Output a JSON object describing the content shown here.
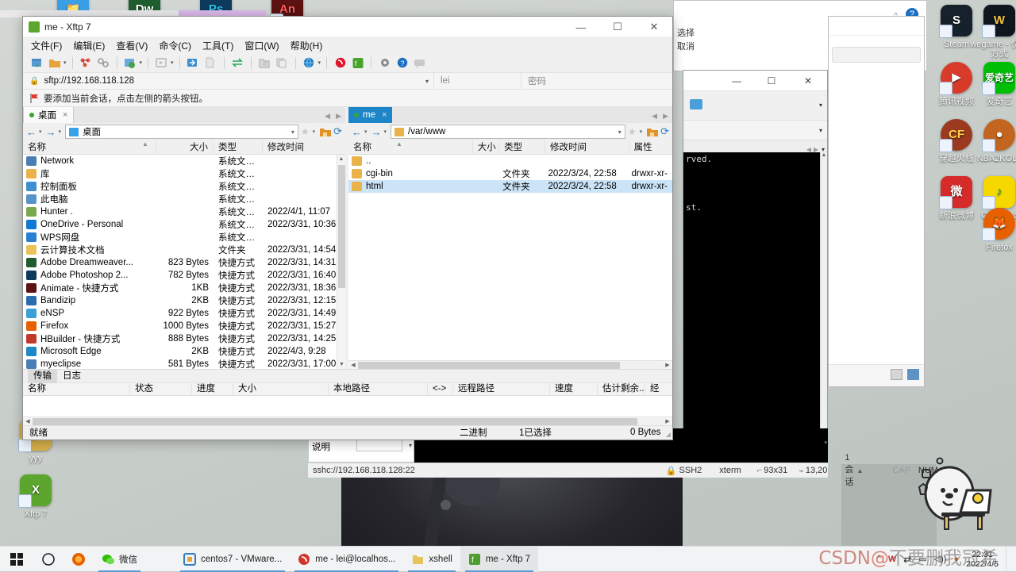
{
  "desktop": {
    "icons_right": [
      {
        "label": "Steam",
        "color": "#1b2838",
        "glyph": "S"
      },
      {
        "label": "wegame - 快捷方式",
        "color": "#101820",
        "glyph": "W"
      },
      {
        "label": "腾讯视频",
        "color": "#d93b2b",
        "glyph": "▶"
      },
      {
        "label": "爱奇艺",
        "color": "#00be06",
        "glyph": "奇"
      },
      {
        "label": "穿越火线",
        "color": "#8c2b1e",
        "glyph": "CF"
      },
      {
        "label": "NBA2KOL2",
        "color": "#c1651f",
        "glyph": "●"
      },
      {
        "label": "新浪微博",
        "color": "#d62b2b",
        "glyph": "微"
      },
      {
        "label": "QQMusic",
        "color": "#f5d800",
        "glyph": "♪"
      },
      {
        "label": "Firefox",
        "color": "#e66000",
        "glyph": "🦊"
      }
    ],
    "icons_left": [
      {
        "label": "yyy",
        "color": "#c9a227",
        "glyph": "📁"
      },
      {
        "label": "Xftp 7",
        "color": "#4f9d2e",
        "glyph": "X"
      }
    ],
    "icons_top": [
      {
        "label": "",
        "color": "#39a0e8",
        "glyph": "📁"
      },
      {
        "label": "Dw",
        "color": "#1f5c2e",
        "glyph": "Dw"
      },
      {
        "label": "Ps",
        "color": "#0b3a5d",
        "glyph": "Ps"
      },
      {
        "label": "An",
        "color": "#5c1212",
        "glyph": "An"
      }
    ]
  },
  "xftp": {
    "title": "me - Xftp 7",
    "window_icon": "xftp-app-icon",
    "titlebar_buttons": {
      "minimize": "—",
      "maximize": "☐",
      "close": "✕"
    },
    "menu": [
      "文件(F)",
      "编辑(E)",
      "查看(V)",
      "命令(C)",
      "工具(T)",
      "窗口(W)",
      "帮助(H)"
    ],
    "toolbar_icons": [
      "new-session-icon",
      "open-folder-icon",
      "caret-down-icon",
      "disconnect-icon",
      "link-icon",
      "sync-browse-icon",
      "caret-down-icon",
      "script-run-icon",
      "caret-down-icon",
      "transfer-in-icon",
      "file-icon",
      "transfer-swap-icon",
      "lock-folder-icon",
      "copy-icon",
      "globe-icon",
      "caret-down-icon",
      "xshell-icon",
      "xftp-icon",
      "settings-gear-icon",
      "help-icon",
      "feedback-icon"
    ],
    "address": {
      "lock_icon": "lock-icon",
      "url": "sftp://192.168.118.128",
      "user_placeholder": "lei",
      "password_placeholder": "密码"
    },
    "hint": {
      "icon": "red-flag-icon",
      "text": "要添加当前会话，点击左侧的箭头按钮。"
    },
    "local_pane": {
      "tab": {
        "label": "桌面",
        "close": "×",
        "dot": "session-dot"
      },
      "path": "桌面",
      "nav": {
        "back": "←",
        "forward": "→",
        "star": "★",
        "home": "⌂",
        "refresh": "⟳"
      },
      "columns": [
        "名称",
        "大小",
        "类型",
        "修改时间"
      ],
      "rows": [
        {
          "name": "Network",
          "icon_color": "#4a7fb5",
          "size": "",
          "type": "系统文件夹",
          "modified": ""
        },
        {
          "name": "库",
          "icon_color": "#e9b34a",
          "size": "",
          "type": "系统文件夹",
          "modified": ""
        },
        {
          "name": "控制面板",
          "icon_color": "#3e8fd0",
          "size": "",
          "type": "系统文件夹",
          "modified": ""
        },
        {
          "name": "此电脑",
          "icon_color": "#5a93c8",
          "size": "",
          "type": "系统文件夹",
          "modified": ""
        },
        {
          "name": "Hunter .",
          "icon_color": "#7aa84f",
          "size": "",
          "type": "系统文件夹",
          "modified": "2022/4/1, 11:07"
        },
        {
          "name": "OneDrive - Personal",
          "icon_color": "#0f78d4",
          "size": "",
          "type": "系统文件夹",
          "modified": "2022/3/31, 10:36"
        },
        {
          "name": "WPS网盘",
          "icon_color": "#2a7fd4",
          "size": "",
          "type": "系统文件夹",
          "modified": ""
        },
        {
          "name": "云计算技术文档",
          "icon_color": "#e9c35a",
          "size": "",
          "type": "文件夹",
          "modified": "2022/3/31, 14:54"
        },
        {
          "name": "Adobe Dreamweaver...",
          "icon_color": "#1f5c2e",
          "size": "823 Bytes",
          "type": "快捷方式",
          "modified": "2022/3/31, 14:31"
        },
        {
          "name": "Adobe Photoshop 2...",
          "icon_color": "#0b3a5d",
          "size": "782 Bytes",
          "type": "快捷方式",
          "modified": "2022/3/31, 16:40"
        },
        {
          "name": "Animate - 快捷方式",
          "icon_color": "#5c1212",
          "size": "1KB",
          "type": "快捷方式",
          "modified": "2022/3/31, 18:36"
        },
        {
          "name": "Bandizip",
          "icon_color": "#2b6cb0",
          "size": "2KB",
          "type": "快捷方式",
          "modified": "2022/3/31, 12:15"
        },
        {
          "name": "eNSP",
          "icon_color": "#3aa0d8",
          "size": "922 Bytes",
          "type": "快捷方式",
          "modified": "2022/3/31, 14:49"
        },
        {
          "name": "Firefox",
          "icon_color": "#e66000",
          "size": "1000 Bytes",
          "type": "快捷方式",
          "modified": "2022/3/31, 15:27"
        },
        {
          "name": "HBuilder - 快捷方式",
          "icon_color": "#c0392b",
          "size": "888 Bytes",
          "type": "快捷方式",
          "modified": "2022/3/31, 14:25"
        },
        {
          "name": "Microsoft Edge",
          "icon_color": "#1e88c7",
          "size": "2KB",
          "type": "快捷方式",
          "modified": "2022/4/3, 9:28"
        },
        {
          "name": "myeclipse",
          "icon_color": "#4a7fb5",
          "size": "581 Bytes",
          "type": "快捷方式",
          "modified": "2022/3/31, 17:00"
        }
      ]
    },
    "remote_pane": {
      "tab": {
        "label": "me",
        "close": "×",
        "dot": "session-dot"
      },
      "path": "/var/www",
      "nav": {
        "back": "←",
        "forward": "→",
        "star": "★",
        "home": "⌂",
        "refresh": "⟳"
      },
      "columns": [
        "名称",
        "大小",
        "类型",
        "修改时间",
        "属性"
      ],
      "rows": [
        {
          "name": "..",
          "icon_color": "#e9b34a",
          "size": "",
          "type": "",
          "modified": "",
          "attr": "",
          "selected": false
        },
        {
          "name": "cgi-bin",
          "icon_color": "#e9b34a",
          "size": "",
          "type": "文件夹",
          "modified": "2022/3/24, 22:58",
          "attr": "drwxr-xr-",
          "selected": false
        },
        {
          "name": "html",
          "icon_color": "#e9b34a",
          "size": "",
          "type": "文件夹",
          "modified": "2022/3/24, 22:58",
          "attr": "drwxr-xr-",
          "selected": true
        }
      ]
    },
    "transfer": {
      "tabs": [
        "传输",
        "日志"
      ],
      "active_tab": "传输",
      "columns": [
        "名称",
        "状态",
        "进度",
        "大小",
        "本地路径",
        "<->",
        "远程路径",
        "速度",
        "估计剩余...",
        "经"
      ],
      "rows": [],
      "status": {
        "left": "就绪",
        "mode": "二进制",
        "selection": "1已选择",
        "size": "0 Bytes"
      }
    }
  },
  "xshell": {
    "titlebar_buttons": {
      "minimize": "—",
      "maximize": "☐",
      "close": "✕"
    },
    "terminal_lines": [
      "rved.",
      "",
      "",
      "",
      "st."
    ],
    "statusbar": {
      "url": "sshc://192.168.118.128:22",
      "lock_icon": "lock-icon",
      "protocol": "SSH2",
      "term": "xterm",
      "size": "93x31",
      "cursor": "13,20",
      "sessions": "1 会话",
      "caps": "CAP",
      "num": "NUM"
    },
    "side_field_label": "说明"
  },
  "behind_window": {
    "options": [
      "选择",
      "取消"
    ],
    "help_icon": "help-icon",
    "collapse_icon": "chevron-up-icon"
  },
  "taskbar": {
    "start_icon": "windows-start-icon",
    "search_icon": "search-circle-icon",
    "pinned": [
      {
        "label": "",
        "icon": "firefox-icon",
        "color": "#e66000"
      },
      {
        "label": "微信",
        "icon": "wechat-icon",
        "color": "#2dc100"
      }
    ],
    "apps": [
      {
        "label": "centos7 - VMware...",
        "icon": "vmware-icon",
        "color": "#2e7cc4",
        "active": false
      },
      {
        "label": "me - lei@localhos...",
        "icon": "xshell-icon",
        "color": "#d0342c",
        "active": false
      },
      {
        "label": "xshell",
        "icon": "folder-icon",
        "color": "#e9c35a",
        "active": false
      },
      {
        "label": "me - Xftp 7",
        "icon": "xftp-icon",
        "color": "#4f9d2e",
        "active": true
      }
    ],
    "tray": [
      {
        "icon": "chevron-up-icon",
        "label": "^"
      },
      {
        "icon": "wps-icon",
        "label": "W"
      },
      {
        "icon": "network-icon",
        "label": "⇄"
      },
      {
        "icon": "battery-icon",
        "label": "▭"
      },
      {
        "icon": "volume-icon",
        "label": "🔊"
      },
      {
        "icon": "qq-icon",
        "label": "Q"
      }
    ],
    "clock": {
      "time": "22:31",
      "date": "2022/4/5"
    },
    "show_desktop": "show-desktop-button"
  },
  "watermark": {
    "prefix": "CSDN",
    "at": "@",
    "text": "不要删我冠希"
  }
}
